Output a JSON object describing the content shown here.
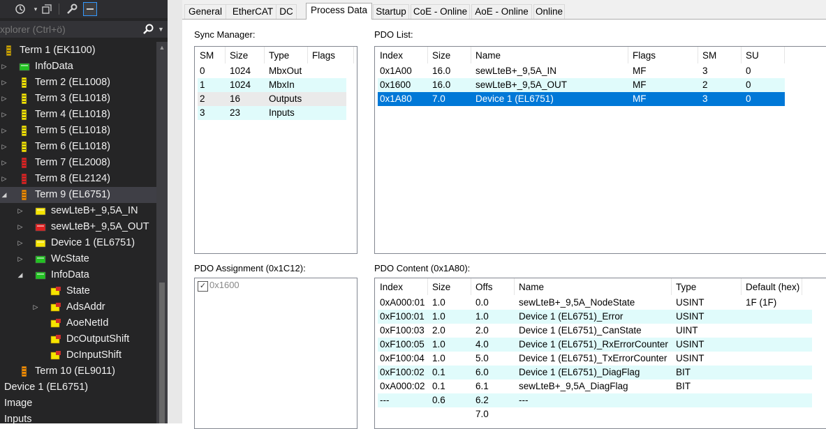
{
  "explorer": {
    "search_placeholder": "xplorer (Ctrl+ö)",
    "toolbar_icons": [
      "history-icon",
      "collapse-all-icon",
      "properties-wrench-icon",
      "preview-icon"
    ],
    "tree": [
      {
        "label": "Term 1 (EK1100)",
        "level": 0,
        "expander": "",
        "icon": "coupler-terminal-icon",
        "iconColor": "#c8a000"
      },
      {
        "label": "InfoData",
        "level": 1,
        "expander": "▷",
        "icon": "infodata-icon",
        "iconColor": "#22c322"
      },
      {
        "label": "Term 2 (EL1008)",
        "level": 1,
        "expander": "▷",
        "icon": "terminal-yellow-icon",
        "iconColor": "#f5e400"
      },
      {
        "label": "Term 3 (EL1018)",
        "level": 1,
        "expander": "▷",
        "icon": "terminal-yellow-icon",
        "iconColor": "#f5e400"
      },
      {
        "label": "Term 4 (EL1018)",
        "level": 1,
        "expander": "▷",
        "icon": "terminal-yellow-icon",
        "iconColor": "#f5e400"
      },
      {
        "label": "Term 5 (EL1018)",
        "level": 1,
        "expander": "▷",
        "icon": "terminal-yellow-icon",
        "iconColor": "#f5e400"
      },
      {
        "label": "Term 6 (EL1018)",
        "level": 1,
        "expander": "▷",
        "icon": "terminal-yellow-icon",
        "iconColor": "#f5e400"
      },
      {
        "label": "Term 7 (EL2008)",
        "level": 1,
        "expander": "▷",
        "icon": "terminal-red-icon",
        "iconColor": "#e02020"
      },
      {
        "label": "Term 8 (EL2124)",
        "level": 1,
        "expander": "▷",
        "icon": "terminal-red-icon",
        "iconColor": "#e02020"
      },
      {
        "label": "Term 9 (EL6751)",
        "level": 1,
        "expander": "◢",
        "icon": "terminal-orange-icon",
        "iconColor": "#f08a00",
        "selected": true
      },
      {
        "label": "sewLteB+_9,5A_IN",
        "level": 2,
        "expander": "▷",
        "icon": "input-pdo-icon",
        "iconColor": "#f5e400"
      },
      {
        "label": "sewLteB+_9,5A_OUT",
        "level": 2,
        "expander": "▷",
        "icon": "output-pdo-icon",
        "iconColor": "#e02020"
      },
      {
        "label": "Device 1 (EL6751)",
        "level": 2,
        "expander": "▷",
        "icon": "input-pdo-icon",
        "iconColor": "#f5e400"
      },
      {
        "label": "WcState",
        "level": 2,
        "expander": "▷",
        "icon": "wcstate-icon",
        "iconColor": "#22c322"
      },
      {
        "label": "InfoData",
        "level": 2,
        "expander": "◢",
        "icon": "infodata-icon",
        "iconColor": "#22c322"
      },
      {
        "label": "State",
        "level": 3,
        "expander": "",
        "icon": "variable-icon",
        "iconColor": "#f5e400"
      },
      {
        "label": "AdsAddr",
        "level": 3,
        "expander": "▷",
        "icon": "variable-icon",
        "iconColor": "#f5e400"
      },
      {
        "label": "AoeNetId",
        "level": 3,
        "expander": "",
        "icon": "variable-icon",
        "iconColor": "#f5e400"
      },
      {
        "label": "DcOutputShift",
        "level": 3,
        "expander": "",
        "icon": "variable-icon",
        "iconColor": "#f5e400"
      },
      {
        "label": "DcInputShift",
        "level": 3,
        "expander": "",
        "icon": "variable-icon",
        "iconColor": "#f5e400"
      },
      {
        "label": "Term 10 (EL9011)",
        "level": 1,
        "expander": "",
        "icon": "end-terminal-icon",
        "iconColor": "#f08a00"
      },
      {
        "label": "Device 1 (EL6751)",
        "level": -1,
        "expander": "",
        "icon": "",
        "iconColor": ""
      },
      {
        "label": "Image",
        "level": -1,
        "expander": "",
        "icon": "image-icon",
        "iconColor": "#e02020"
      },
      {
        "label": "Inputs",
        "level": -1,
        "expander": "",
        "icon": "inputs-icon",
        "iconColor": "#f5e400"
      }
    ]
  },
  "tabs": [
    "General",
    "EtherCAT",
    "DC",
    "Process Data",
    "Startup",
    "CoE - Online",
    "AoE - Online",
    "Online"
  ],
  "active_tab": "Process Data",
  "sync_manager": {
    "caption": "Sync Manager:",
    "columns": [
      "SM",
      "Size",
      "Type",
      "Flags"
    ],
    "rows": [
      [
        "0",
        "1024",
        "MbxOut",
        ""
      ],
      [
        "1",
        "1024",
        "MbxIn",
        ""
      ],
      [
        "2",
        "16",
        "Outputs",
        ""
      ],
      [
        "3",
        "23",
        "Inputs",
        ""
      ]
    ]
  },
  "pdo_list": {
    "caption": "PDO List:",
    "columns": [
      "Index",
      "Size",
      "Name",
      "Flags",
      "SM",
      "SU"
    ],
    "rows": [
      [
        "0x1A00",
        "16.0",
        "sewLteB+_9,5A_IN",
        "MF",
        "3",
        "0"
      ],
      [
        "0x1600",
        "16.0",
        "sewLteB+_9,5A_OUT",
        "MF",
        "2",
        "0"
      ],
      [
        "0x1A80",
        "7.0",
        "Device 1 (EL6751)",
        "MF",
        "3",
        "0"
      ]
    ],
    "selected_row": 2
  },
  "pdo_assignment": {
    "caption": "PDO Assignment (0x1C12):",
    "items": [
      {
        "label": "0x1600",
        "checked": true
      }
    ]
  },
  "pdo_content": {
    "caption": "PDO Content (0x1A80):",
    "columns": [
      "Index",
      "Size",
      "Offs",
      "Name",
      "Type",
      "Default (hex)"
    ],
    "rows": [
      [
        "0xA000:01",
        "1.0",
        "0.0",
        "sewLteB+_9,5A_NodeState",
        "USINT",
        "1F (1F)"
      ],
      [
        "0xF100:01",
        "1.0",
        "1.0",
        "Device 1 (EL6751)_Error",
        "USINT",
        ""
      ],
      [
        "0xF100:03",
        "2.0",
        "2.0",
        "Device 1 (EL6751)_CanState",
        "UINT",
        ""
      ],
      [
        "0xF100:05",
        "1.0",
        "4.0",
        "Device 1 (EL6751)_RxErrorCounter",
        "USINT",
        ""
      ],
      [
        "0xF100:04",
        "1.0",
        "5.0",
        "Device 1 (EL6751)_TxErrorCounter",
        "USINT",
        ""
      ],
      [
        "0xF100:02",
        "0.1",
        "6.0",
        "Device 1 (EL6751)_DiagFlag",
        "BIT",
        ""
      ],
      [
        "0xA000:02",
        "0.1",
        "6.1",
        "sewLteB+_9,5A_DiagFlag",
        "BIT",
        ""
      ],
      [
        "---",
        "0.6",
        "6.2",
        "---",
        "",
        ""
      ],
      [
        "",
        "",
        "7.0",
        "",
        "",
        ""
      ]
    ]
  }
}
